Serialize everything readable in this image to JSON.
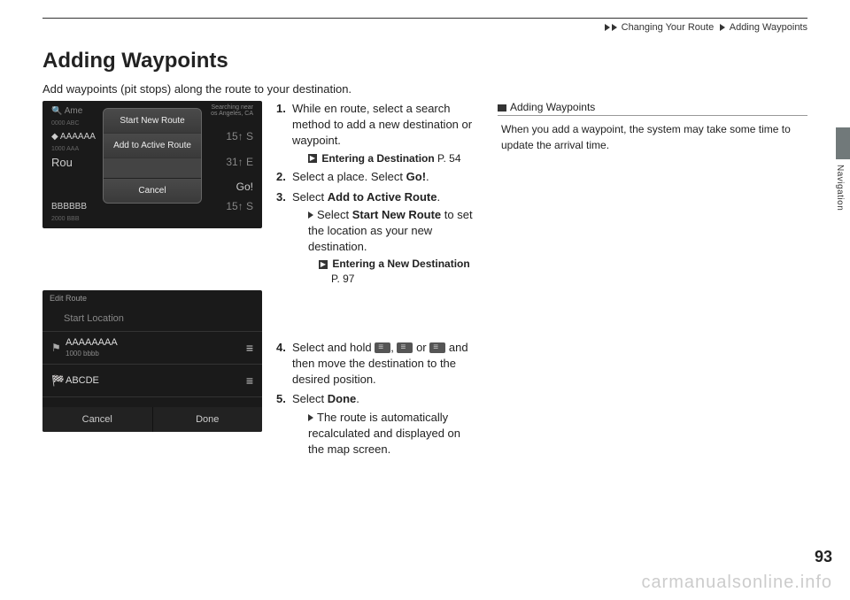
{
  "breadcrumb": {
    "section": "Changing Your Route",
    "subsection": "Adding Waypoints"
  },
  "title": "Adding Waypoints",
  "intro": "Add waypoints (pit stops) along the route to your destination.",
  "screen1": {
    "search_prefix": "Ame",
    "search_near": "Searching near",
    "search_city": "os Angeles, CA",
    "tiny1": "0000 ABC",
    "row1_left": "AAAAAA",
    "row1_sub": "1000 AAA",
    "row2_left": "Rou",
    "row3_left": "BBBBBB",
    "tiny2": "2000 BBB",
    "row1_right": "15↑  S",
    "row2_right": "31↑  E",
    "row3_right": "Go!",
    "row4_right": "15↑  S",
    "modal": {
      "btn1": "Start New Route",
      "btn2": "Add to Active Route",
      "cancel": "Cancel"
    }
  },
  "screen2": {
    "header": "Edit Route",
    "start": "Start Location",
    "row1": "AAAAAAAA",
    "row1_sub": "1000 bbbb",
    "row2": "ABCDE",
    "cancel": "Cancel",
    "done": "Done"
  },
  "steps": {
    "s1": "While en route, select a search method to add a new destination or waypoint.",
    "s1_ref_label": "Entering a Destination",
    "s1_ref_page": "P. 54",
    "s2_a": "Select a place. Select ",
    "s2_b": "Go!",
    "s2_c": ".",
    "s3_a": "Select ",
    "s3_b": "Add to Active Route",
    "s3_c": ".",
    "s3_sub_a": "Select ",
    "s3_sub_b": "Start New Route",
    "s3_sub_c": " to set the location as your new destination.",
    "s3_ref_label": "Entering a New Destination",
    "s3_ref_page": "P. 97",
    "s4_a": "Select and hold ",
    "s4_b": ", ",
    "s4_c": " or ",
    "s4_d": " and then move the destination to the desired position.",
    "s5_a": "Select ",
    "s5_b": "Done",
    "s5_c": ".",
    "s5_sub": "The route is automatically recalculated and displayed on the map screen."
  },
  "sidebar_note": {
    "heading": "Adding Waypoints",
    "body": "When you add a waypoint, the system may take some time to update the arrival time."
  },
  "side_label": "Navigation",
  "page_number": "93",
  "watermark": "carmanualsonline.info"
}
